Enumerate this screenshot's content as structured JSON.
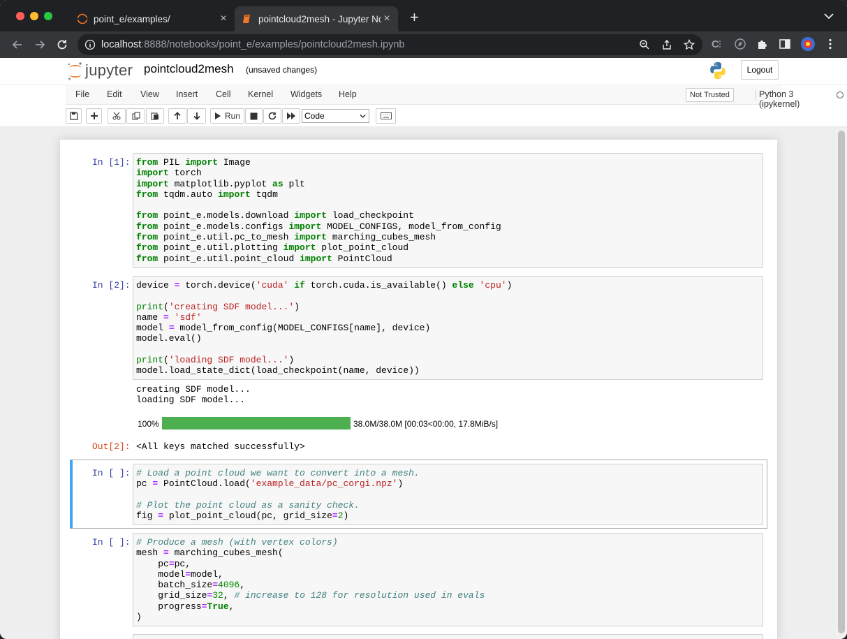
{
  "browser": {
    "tabs": [
      {
        "title": "point_e/examples/",
        "active": false
      },
      {
        "title": "pointcloud2mesh - Jupyter Not",
        "active": true
      }
    ],
    "url_host": "localhost",
    "url_rest": ":8888/notebooks/point_e/examples/pointcloud2mesh.ipynb"
  },
  "jupyter": {
    "logo_text": "jupyter",
    "notebook_name": "pointcloud2mesh",
    "save_status": "(unsaved changes)",
    "logout_label": "Logout",
    "menu": [
      "File",
      "Edit",
      "View",
      "Insert",
      "Cell",
      "Kernel",
      "Widgets",
      "Help"
    ],
    "trust_label": "Not Trusted",
    "kernel_name": "Python 3 (ipykernel)",
    "run_label": "Run",
    "cell_type": "Code"
  },
  "cells": {
    "c1": {
      "prompt": "In [1]:"
    },
    "c2": {
      "prompt": "In [2]:",
      "stdout": "creating SDF model...\nloading SDF model...",
      "out_prompt": "Out[2]:",
      "result": "<All keys matched successfully>"
    },
    "c3": {
      "prompt": "In [ ]:"
    },
    "c4": {
      "prompt": "In [ ]:"
    }
  },
  "progress": {
    "percent_label": "100%",
    "fraction": 1.0,
    "info": "38.0M/38.0M [00:03<00:00, 17.8MiB/s]"
  },
  "colors": {
    "progress_fill": "#4caf50",
    "selected_cell_border": "#42a5f5",
    "prompt_in": "#303f9f",
    "prompt_out": "#d84315"
  }
}
